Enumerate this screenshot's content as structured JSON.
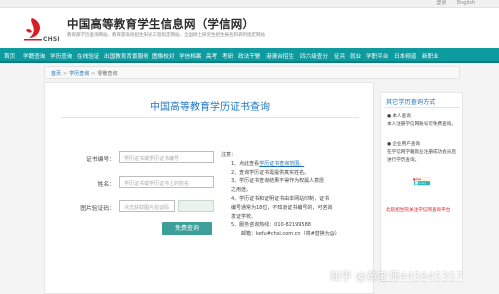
{
  "topbar": {
    "links": [
      "登录",
      "English"
    ]
  },
  "header": {
    "logo_text": "CHSI",
    "title": "中国高等教育学生信息网（学信网）",
    "subtitle": "教育部学历查询网站、教育部高校招生阳光工程指定网站、全国硕士研究生招生报名和调剂指定网站"
  },
  "nav": {
    "items": [
      "首页",
      "学籍查询",
      "学历查询",
      "在线验证",
      "出国教育背景服务",
      "图像校对",
      "学信档案",
      "高考",
      "考研",
      "政法干警",
      "港澳台招生",
      "四六级查分",
      "征兵",
      "就业",
      "学职平台",
      "日本频道",
      "新职业"
    ]
  },
  "breadcrumb": {
    "home": "首页",
    "level1": "学历查询",
    "level2": "零散查询"
  },
  "main": {
    "title": "中国高等教育学历证书查询",
    "form": {
      "cert_label": "证书编号：",
      "cert_placeholder": "学历证书或学历证书编号",
      "name_label": "姓名：",
      "name_placeholder": "学历证书或学历证书上的姓名",
      "captcha_label": "图片验证码：",
      "captcha_placeholder": "点击获取图片验证码",
      "submit_label": "免费查询"
    },
    "notes": {
      "heading": "注意：",
      "items": [
        "1、点此查看",
        "学历证书查询范围。",
        "2、查询学历证书需提供真实姓名。",
        "3、学历证书查询结果不得作为权属人意愿",
        "之用途。",
        "4、学历证书和证明证书由本网站印制，证书",
        "编号通常为18位，不知道证书编号的，可咨询",
        "发证学校。",
        "5、服务咨询热线：010-82199588",
        "邮箱：kefu#chsi.com.cn（将#替换为@）"
      ]
    }
  },
  "sidebar": {
    "title": "其它学历查询方式",
    "items": [
      "● 本人查询",
      "本人注册学信网账号可免费查询。",
      "● 企业用户查询",
      "在学信网学籍就业注册成功会员后",
      "进行学历查询。"
    ],
    "banner_text": "学信网",
    "banner_big": "聘",
    "banner_small": "就业服务",
    "footer": "北航招生院关注学信网查询平台"
  },
  "watermark": "知乎 @黄老师445645357",
  "colors": {
    "nav_teal": "#0e9ba0",
    "title_blue": "#1f76c2",
    "button_teal": "#3d9e9a",
    "logo_red": "#d51e26"
  }
}
